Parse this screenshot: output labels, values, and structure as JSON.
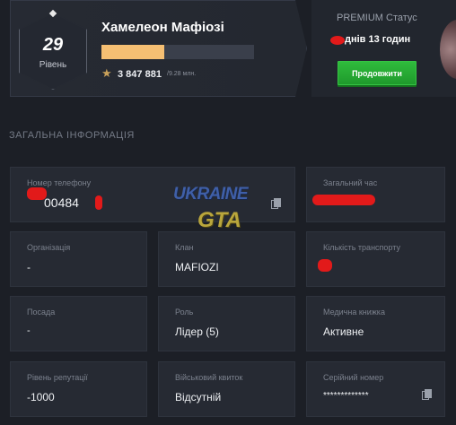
{
  "profile": {
    "level_number": "29",
    "level_label": "Рівень",
    "name": "Хамелеон Мафіозі",
    "xp_progress": 0.41,
    "xp_value": "3 847 881",
    "xp_max": "/9.28 млн."
  },
  "premium": {
    "title": "PREMIUM Статус",
    "remaining": "днів 13 годин",
    "extend_label": "Продовжити"
  },
  "section": {
    "title": "ЗАГАЛЬНА ІНФОРМАЦІЯ"
  },
  "info": {
    "phone": {
      "label": "Номер телефону",
      "value": "00484"
    },
    "total_time": {
      "label": "Загальний час",
      "value": ""
    },
    "organization": {
      "label": "Організація",
      "value": "-"
    },
    "clan": {
      "label": "Клан",
      "value": "MAFIOZI"
    },
    "vehicles": {
      "label": "Кількість транспорту",
      "value": ""
    },
    "position": {
      "label": "Посада",
      "value": "-"
    },
    "role": {
      "label": "Роль",
      "value": "Лідер (5)"
    },
    "medical_book": {
      "label": "Медична книжка",
      "value": "Активне"
    },
    "reputation": {
      "label": "Рівень репутації",
      "value": "-1000"
    },
    "military_id": {
      "label": "Військовий квиток",
      "value": "Відсутній"
    },
    "serial_number": {
      "label": "Серійний номер",
      "value": "*************"
    }
  },
  "watermark": {
    "line1": "UKRAINE",
    "line2": "GTA"
  },
  "colors": {
    "background": "#1c1f26",
    "card": "#262a33",
    "xp_fill": "#f5bf73",
    "button_green": "#2fbb3c",
    "redaction": "#e21a1a"
  },
  "icons": [
    "star-icon",
    "copy-icon",
    "diamond-icon"
  ]
}
